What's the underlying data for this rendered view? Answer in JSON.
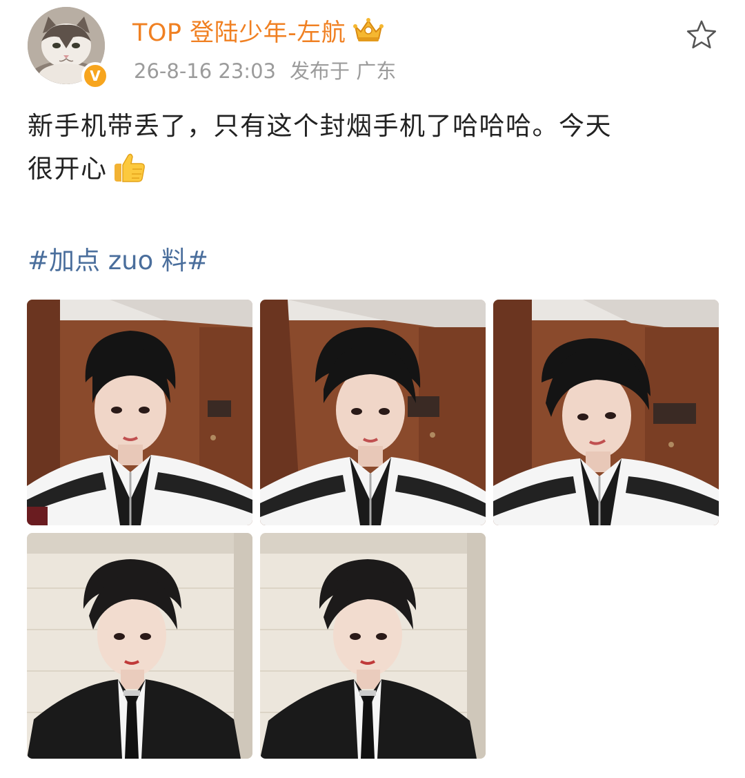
{
  "post": {
    "author": {
      "name": "TOP 登陆少年-左航",
      "verified_mark": "V",
      "avatar_icon": "cat-avatar",
      "rank_icon": "crown-badge-icon"
    },
    "meta": {
      "timestamp": "26-8-16 23:03",
      "location": "发布于 广东"
    },
    "favorite_icon": "star-outline-icon",
    "text_lines": [
      "新手机带丢了，只有这个封烟手机了哈哈哈。今天",
      "很开心"
    ],
    "emoji": "thumbs-up-emoji",
    "hashtag": "#加点 zuo 料#",
    "photos": [
      {
        "scene": "wood-door",
        "outfit": "white-jacket"
      },
      {
        "scene": "wood-door",
        "outfit": "white-jacket"
      },
      {
        "scene": "wood-door",
        "outfit": "white-jacket"
      },
      {
        "scene": "white-wall",
        "outfit": "black-suit"
      },
      {
        "scene": "white-wall",
        "outfit": "black-suit"
      }
    ],
    "colors": {
      "username": "#f08022",
      "hashtag": "#4a6e9c",
      "meta": "#9b9b9b",
      "badge": "#f7a51e"
    }
  }
}
